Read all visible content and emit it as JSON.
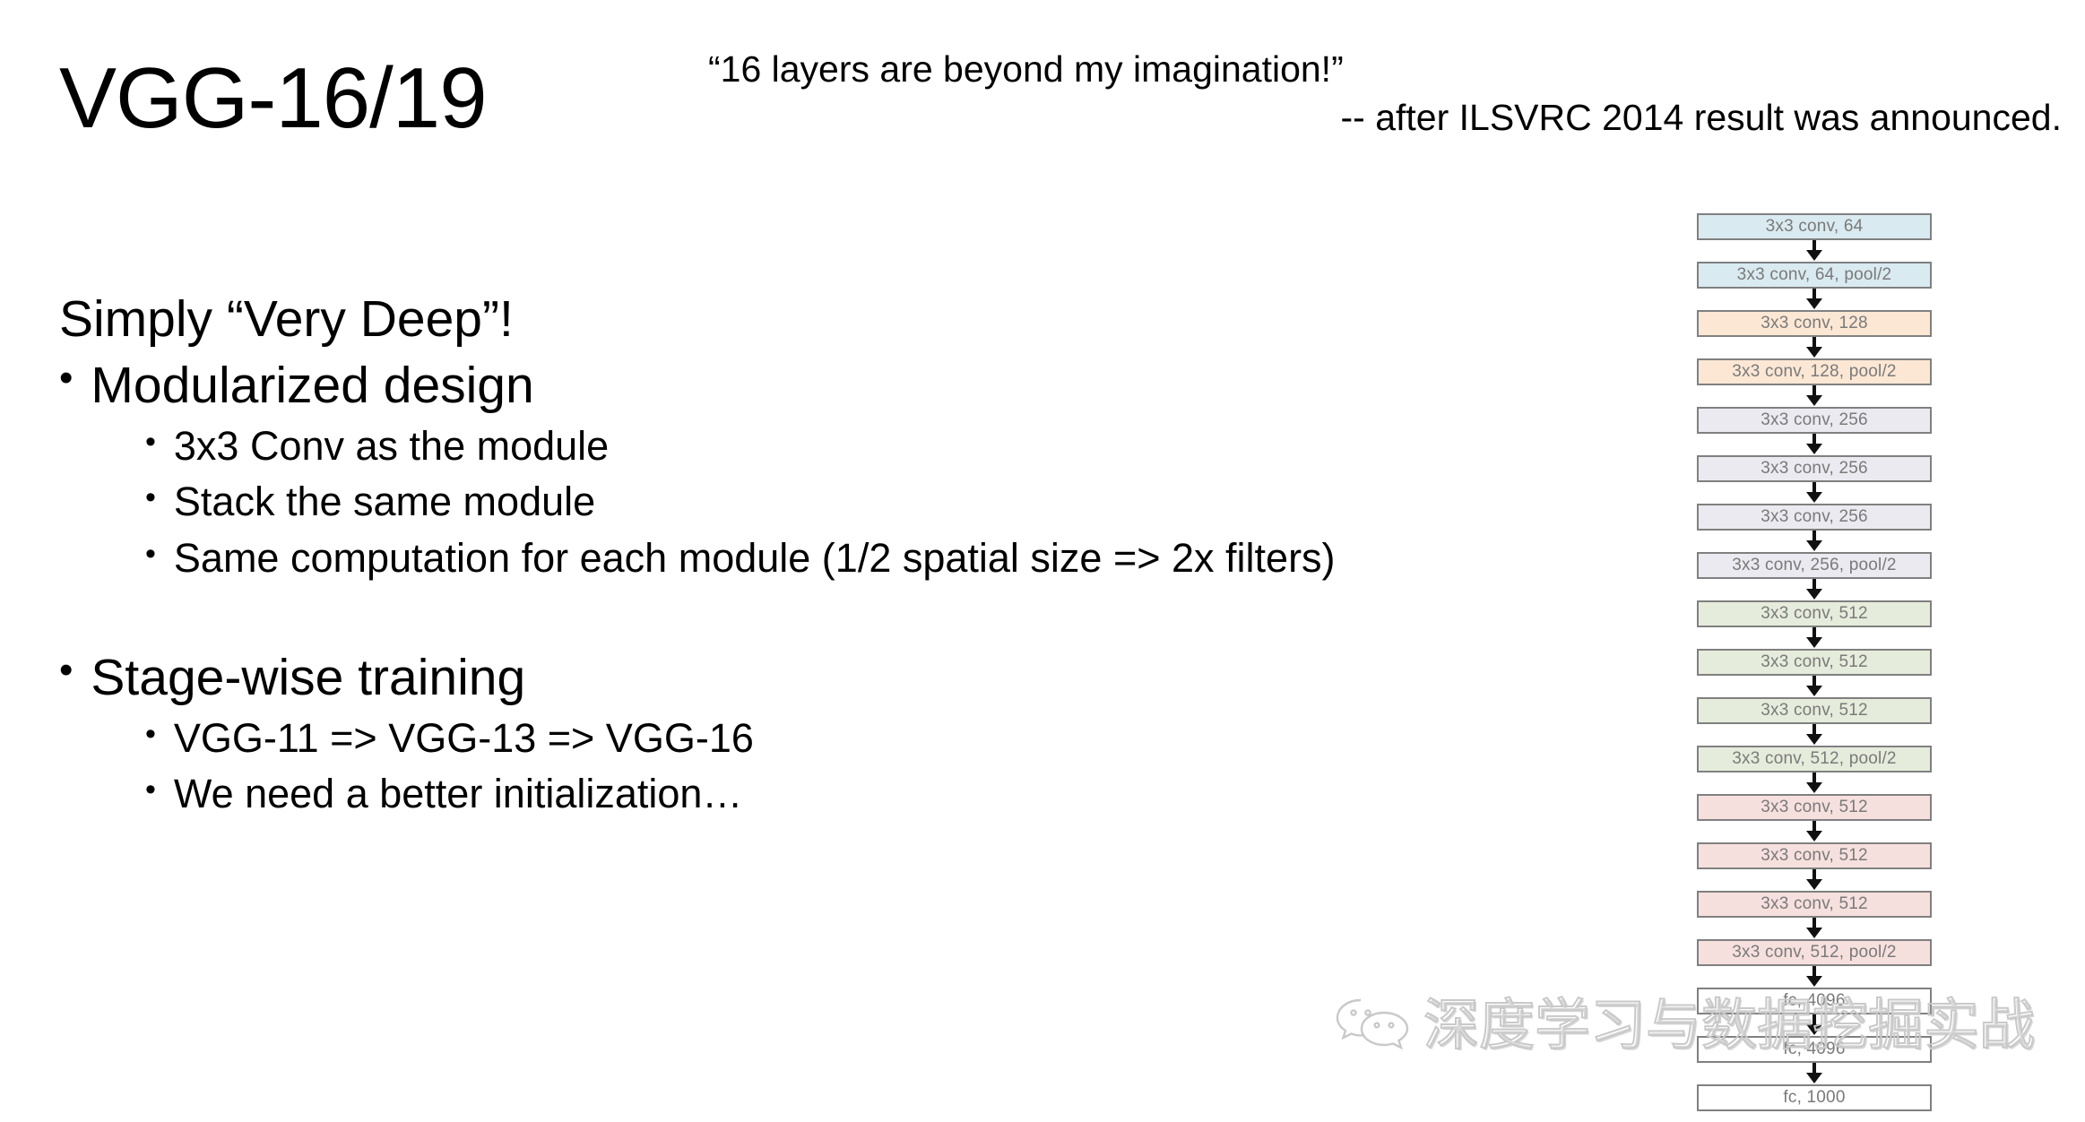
{
  "slide": {
    "title": "VGG-16/19",
    "quote": "“16 layers are beyond my imagination!”",
    "attribution": "-- after ILSVRC 2014 result was announced."
  },
  "body": {
    "heading": "Simply “Very Deep”!",
    "bullet_glyph": "•",
    "items": [
      {
        "level": 1,
        "text": "Modularized design",
        "children": [
          "3x3 Conv as the module",
          "Stack the same module",
          "Same computation for each module (1/2 spatial size => 2x filters)"
        ]
      },
      {
        "level": 1,
        "text": "Stage-wise training",
        "children": [
          "VGG-11 => VGG-13 => VGG-16",
          "We need a better initialization…"
        ]
      }
    ]
  },
  "architecture": {
    "blocks": [
      {
        "label": "3x3 conv, 64",
        "color": "#d9eaf0"
      },
      {
        "label": "3x3 conv, 64, pool/2",
        "color": "#d9eaf0"
      },
      {
        "label": "3x3 conv, 128",
        "color": "#fbe7d4"
      },
      {
        "label": "3x3 conv, 128, pool/2",
        "color": "#fbe7d4"
      },
      {
        "label": "3x3 conv, 256",
        "color": "#eaeaf0"
      },
      {
        "label": "3x3 conv, 256",
        "color": "#eaeaf0"
      },
      {
        "label": "3x3 conv, 256",
        "color": "#eaeaf0"
      },
      {
        "label": "3x3 conv, 256, pool/2",
        "color": "#eaeaf0"
      },
      {
        "label": "3x3 conv, 512",
        "color": "#e6ecdb"
      },
      {
        "label": "3x3 conv, 512",
        "color": "#e6ecdb"
      },
      {
        "label": "3x3 conv, 512",
        "color": "#e6ecdb"
      },
      {
        "label": "3x3 conv, 512, pool/2",
        "color": "#e6ecdb"
      },
      {
        "label": "3x3 conv, 512",
        "color": "#f6e0dd"
      },
      {
        "label": "3x3 conv, 512",
        "color": "#f6e0dd"
      },
      {
        "label": "3x3 conv, 512",
        "color": "#f6e0dd"
      },
      {
        "label": "3x3 conv, 512, pool/2",
        "color": "#f6e0dd"
      },
      {
        "label": "fc, 4096",
        "color": "#ffffff"
      },
      {
        "label": "fc, 4096",
        "color": "#ffffff"
      },
      {
        "label": "fc, 1000",
        "color": "#ffffff"
      }
    ],
    "border_color": "#808080",
    "text_color": "#7a7a7a"
  },
  "watermark": {
    "text": "深度学习与数据挖掘实战",
    "logo": "wechat-icon"
  }
}
